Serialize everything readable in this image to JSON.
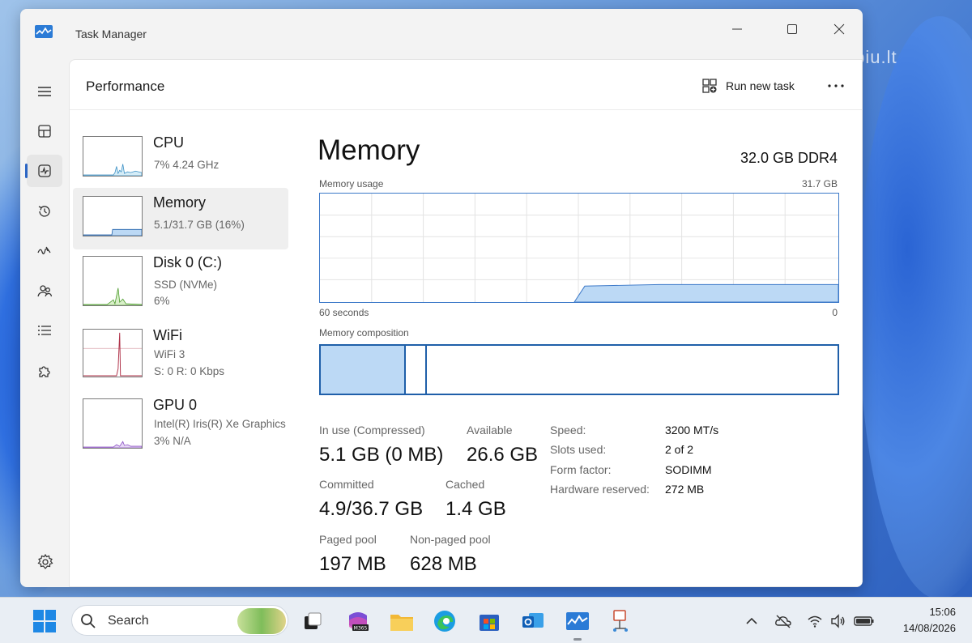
{
  "window": {
    "title": "Task Manager"
  },
  "header": {
    "page_title": "Performance",
    "run_task_label": "Run new task"
  },
  "devices": [
    {
      "name": "CPU",
      "line1": "7% 4.24 GHz",
      "line2": ""
    },
    {
      "name": "Memory",
      "line1": "5.1/31.7 GB (16%)",
      "line2": ""
    },
    {
      "name": "Disk 0 (C:)",
      "line1": "SSD (NVMe)",
      "line2": "6%"
    },
    {
      "name": "WiFi",
      "line1": "WiFi 3",
      "line2": "S: 0 R: 0 Kbps"
    },
    {
      "name": "GPU 0",
      "line1": "Intel(R) Iris(R) Xe Graphics",
      "line2": "3% N/A"
    }
  ],
  "detail": {
    "title": "Memory",
    "spec": "32.0 GB DDR4",
    "usage_label": "Memory usage",
    "usage_max": "31.7 GB",
    "time_left": "60 seconds",
    "time_right": "0",
    "composition_label": "Memory composition",
    "stats": {
      "in_use_label": "In use (Compressed)",
      "in_use_value": "5.1 GB (0 MB)",
      "available_label": "Available",
      "available_value": "26.6 GB",
      "committed_label": "Committed",
      "committed_value": "4.9/36.7 GB",
      "cached_label": "Cached",
      "cached_value": "1.4 GB",
      "paged_label": "Paged pool",
      "paged_value": "197 MB",
      "nonpaged_label": "Non-paged pool",
      "nonpaged_value": "628 MB"
    },
    "props": [
      {
        "label": "Speed:",
        "value": "3200 MT/s"
      },
      {
        "label": "Slots used:",
        "value": "2 of 2"
      },
      {
        "label": "Form factor:",
        "value": "SODIMM"
      },
      {
        "label": "Hardware reserved:",
        "value": "272 MB"
      }
    ]
  },
  "taskbar": {
    "search_label": "Search",
    "time": "15:06",
    "date": "14/08/2026",
    "m365_label": "M365"
  },
  "watermark": "skelbiu.lt",
  "colors": {
    "accent": "#2b65c4",
    "memory_line": "#1f5fa9",
    "memory_fill": "#bcd9f5",
    "cpu_line": "#3b8fc4",
    "disk_line": "#4a9b2a",
    "wifi_line": "#b0334a",
    "gpu_line": "#8a4fc4"
  }
}
